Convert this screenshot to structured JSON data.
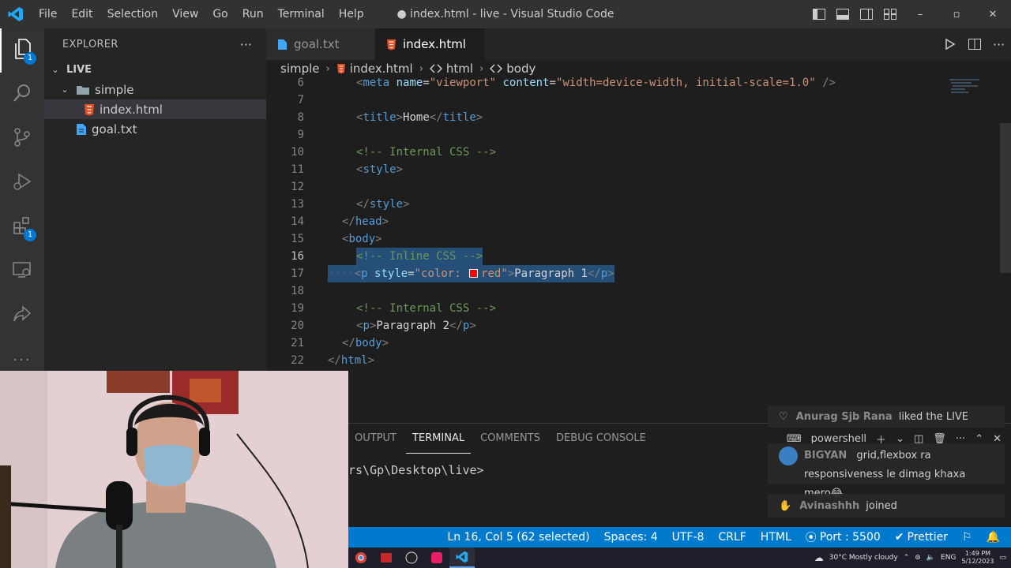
{
  "window": {
    "title": "● index.html - live - Visual Studio Code",
    "menu": [
      "File",
      "Edit",
      "Selection",
      "View",
      "Go",
      "Run",
      "Terminal",
      "Help"
    ],
    "controls": [
      "–",
      "▫",
      "✕"
    ]
  },
  "activity_bar": {
    "items": [
      {
        "icon": "files-icon",
        "badge": "1"
      },
      {
        "icon": "search-icon",
        "badge": ""
      },
      {
        "icon": "source-control-icon",
        "badge": ""
      },
      {
        "icon": "run-debug-icon",
        "badge": ""
      },
      {
        "icon": "extensions-icon",
        "badge": "1"
      },
      {
        "icon": "remote-explorer-icon",
        "badge": ""
      },
      {
        "icon": "live-share-icon",
        "badge": ""
      },
      {
        "icon": "more-icon",
        "badge": ""
      }
    ]
  },
  "sidebar": {
    "title": "EXPLORER",
    "more": "···",
    "root": "LIVE",
    "folder": "simple",
    "files": [
      "index.html",
      "goal.txt"
    ]
  },
  "tabs": [
    {
      "label": "goal.txt",
      "icon": "text-file-icon",
      "active": false
    },
    {
      "label": "index.html",
      "icon": "html5-icon",
      "active": true,
      "dirty": true
    }
  ],
  "breadcrumb": [
    "simple",
    "index.html",
    "html",
    "body"
  ],
  "code": {
    "current_line": "16",
    "lines": [
      {
        "n": "6",
        "text": "<meta name=\"viewport\" content=\"width=device-width, initial-scale=1.0\" />"
      },
      {
        "n": "7",
        "text": ""
      },
      {
        "n": "8",
        "text": "<title>Home</title>"
      },
      {
        "n": "9",
        "text": ""
      },
      {
        "n": "10",
        "text": "<!-- Internal CSS -->"
      },
      {
        "n": "11",
        "text": "<style>"
      },
      {
        "n": "12",
        "text": ""
      },
      {
        "n": "13",
        "text": "</style>"
      },
      {
        "n": "14",
        "text": "</head>"
      },
      {
        "n": "15",
        "text": "<body>"
      },
      {
        "n": "16",
        "text": "<!-- Inline CSS -->"
      },
      {
        "n": "17",
        "text": "<p style=\"color: red\">Paragraph 1</p>"
      },
      {
        "n": "18",
        "text": ""
      },
      {
        "n": "19",
        "text": "<!-- Internal CSS -->"
      },
      {
        "n": "20",
        "text": "<p>Paragraph 2</p>"
      },
      {
        "n": "21",
        "text": "</body>"
      },
      {
        "n": "22",
        "text": "</html>"
      }
    ],
    "swatch_color": "#ff0000"
  },
  "panel": {
    "tabs": [
      "OUTPUT",
      "TERMINAL",
      "COMMENTS",
      "DEBUG CONSOLE"
    ],
    "active_tab": "TERMINAL",
    "terminal_name": "powershell",
    "terminal_text": "rs\\Gp\\Desktop\\live>"
  },
  "notifications": [
    {
      "name": "Anurag Sjb Rana",
      "message": "liked the LIVE"
    },
    {
      "name": "BIGYAN",
      "message": "grid,flexbox ra responsiveness le dimag khaxa mero😂"
    },
    {
      "name": "Avinashhh",
      "message": "joined"
    }
  ],
  "status_bar": {
    "position": "Ln 16, Col 5 (62 selected)",
    "spaces": "Spaces: 4",
    "encoding": "UTF-8",
    "eol": "CRLF",
    "language": "HTML",
    "port": "Port : 5500",
    "prettier": "Prettier"
  },
  "taskbar": {
    "weather": "30°C  Mostly cloudy",
    "lang": "ENG",
    "time": "1:49 PM",
    "date": "5/12/2023"
  },
  "colors": {
    "accent": "#007acc",
    "selection": "#264f78",
    "html_icon": "#e44d26"
  }
}
